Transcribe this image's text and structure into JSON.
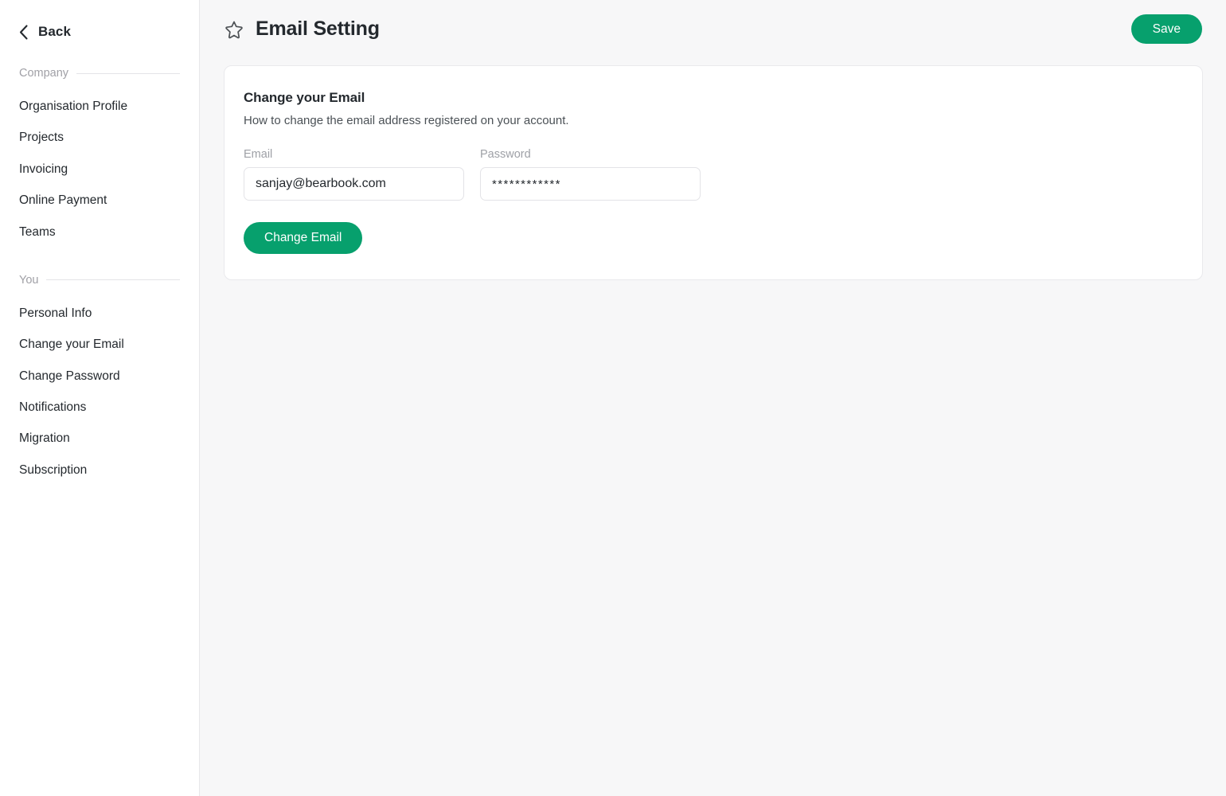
{
  "sidebar": {
    "back": {
      "label": "Back",
      "icon": "chevron-left-icon"
    },
    "sections": [
      {
        "label": "Company",
        "items": [
          {
            "label": "Organisation Profile"
          },
          {
            "label": "Projects"
          },
          {
            "label": "Invoicing"
          },
          {
            "label": "Online Payment"
          },
          {
            "label": "Teams"
          }
        ]
      },
      {
        "label": "You",
        "items": [
          {
            "label": "Personal Info"
          },
          {
            "label": "Change your Email"
          },
          {
            "label": "Change Password"
          },
          {
            "label": "Notifications"
          },
          {
            "label": "Migration"
          },
          {
            "label": "Subscription"
          }
        ]
      }
    ]
  },
  "header": {
    "favorite_icon": "star-outline-icon",
    "title": "Email Setting",
    "save_label": "Save"
  },
  "card": {
    "title": "Change your Email",
    "subtitle": "How to change the email address registered on your account.",
    "fields": {
      "email": {
        "label": "Email",
        "value": "sanjay@bearbook.com",
        "placeholder": "Email"
      },
      "password": {
        "label": "Password",
        "value": "************",
        "placeholder": "Password"
      }
    },
    "submit_label": "Change Email"
  },
  "colors": {
    "accent_green": "#07a06d",
    "page_background": "#f7f7f8",
    "card_background": "#ffffff",
    "border": "#e9e9ec",
    "text_primary": "#24292e",
    "text_muted": "#9ea0a6"
  }
}
